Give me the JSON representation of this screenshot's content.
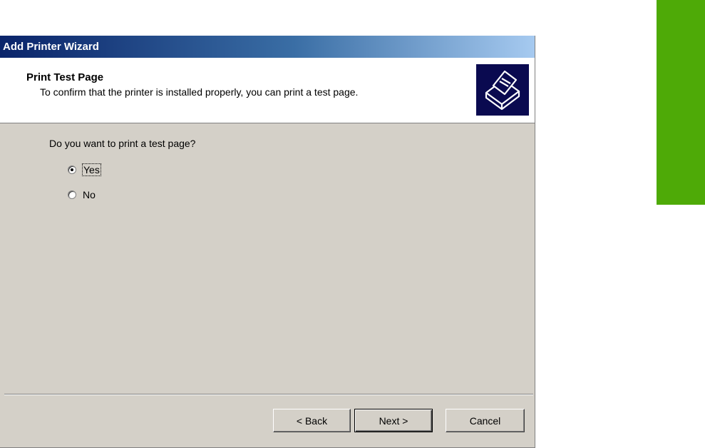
{
  "window": {
    "title": "Add Printer Wizard"
  },
  "header": {
    "title": "Print Test Page",
    "subtitle": "To confirm that the printer is installed properly, you can print a test page.",
    "icon": "printer-icon"
  },
  "question": "Do you want to print a test page?",
  "options": [
    {
      "label": "Yes",
      "selected": true
    },
    {
      "label": "No",
      "selected": false
    }
  ],
  "buttons": {
    "back": "< Back",
    "next": "Next >",
    "cancel": "Cancel"
  },
  "colors": {
    "accent_green": "#4eaa07",
    "titlebar_start": "#0a246a",
    "titlebar_end": "#a6caf0",
    "dialog_bg": "#d4d0c8"
  }
}
